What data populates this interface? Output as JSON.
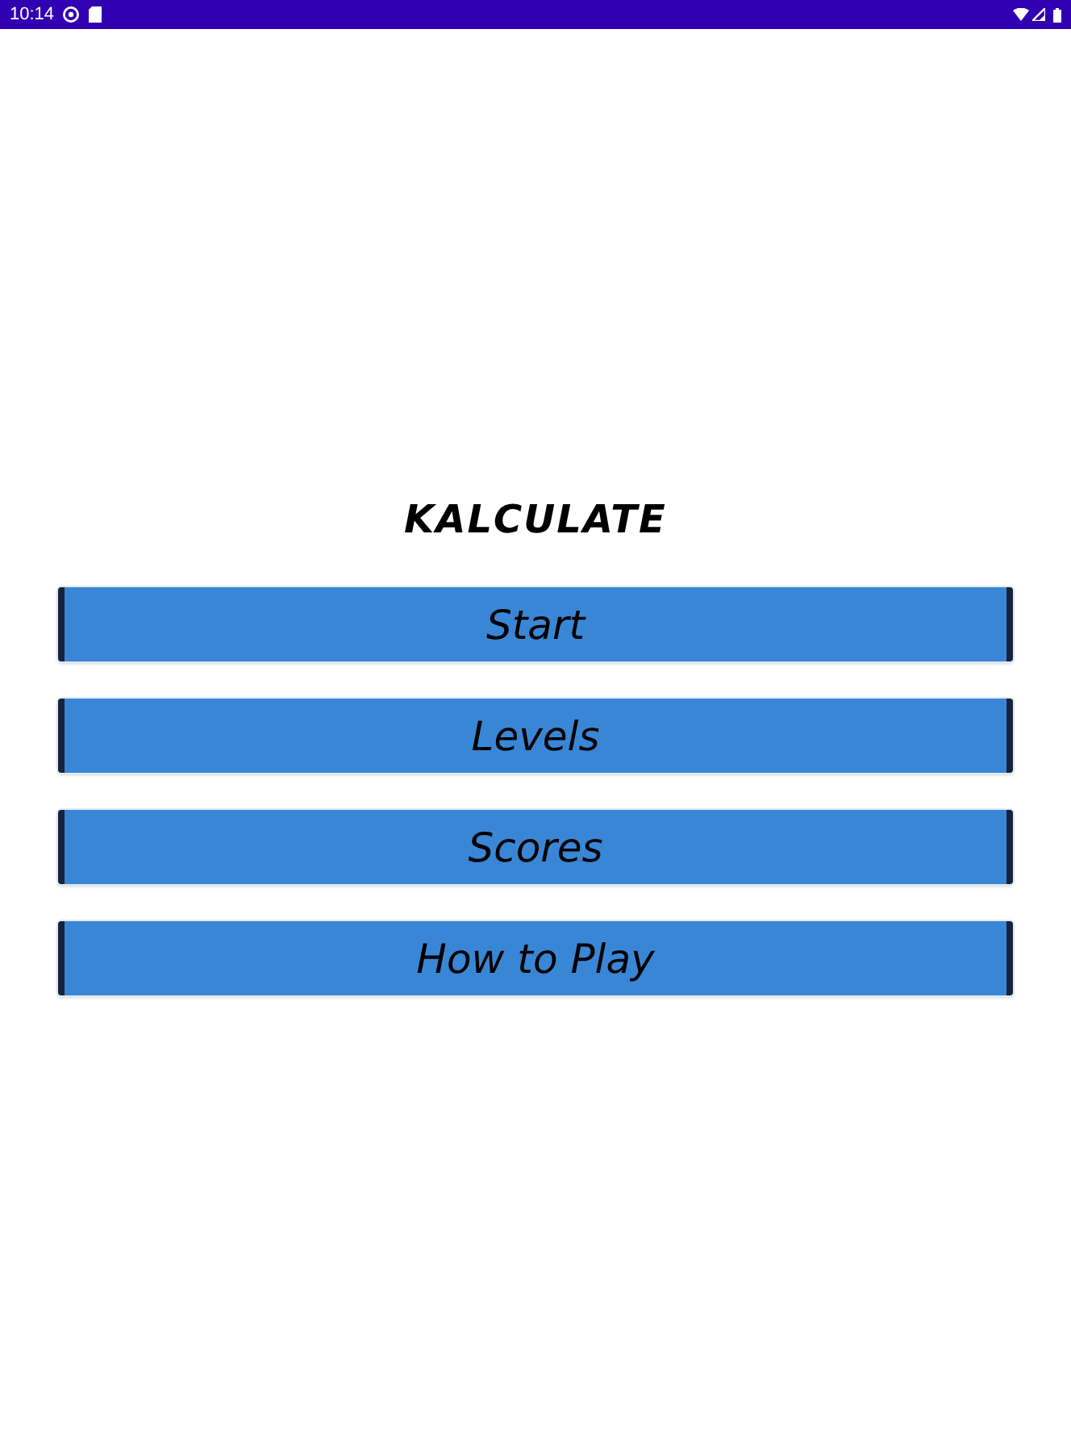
{
  "status_bar": {
    "time": "10:14"
  },
  "title": "KALCULATE",
  "menu": [
    {
      "label": "Start"
    },
    {
      "label": "Levels"
    },
    {
      "label": "Scores"
    },
    {
      "label": "How to Play"
    }
  ]
}
